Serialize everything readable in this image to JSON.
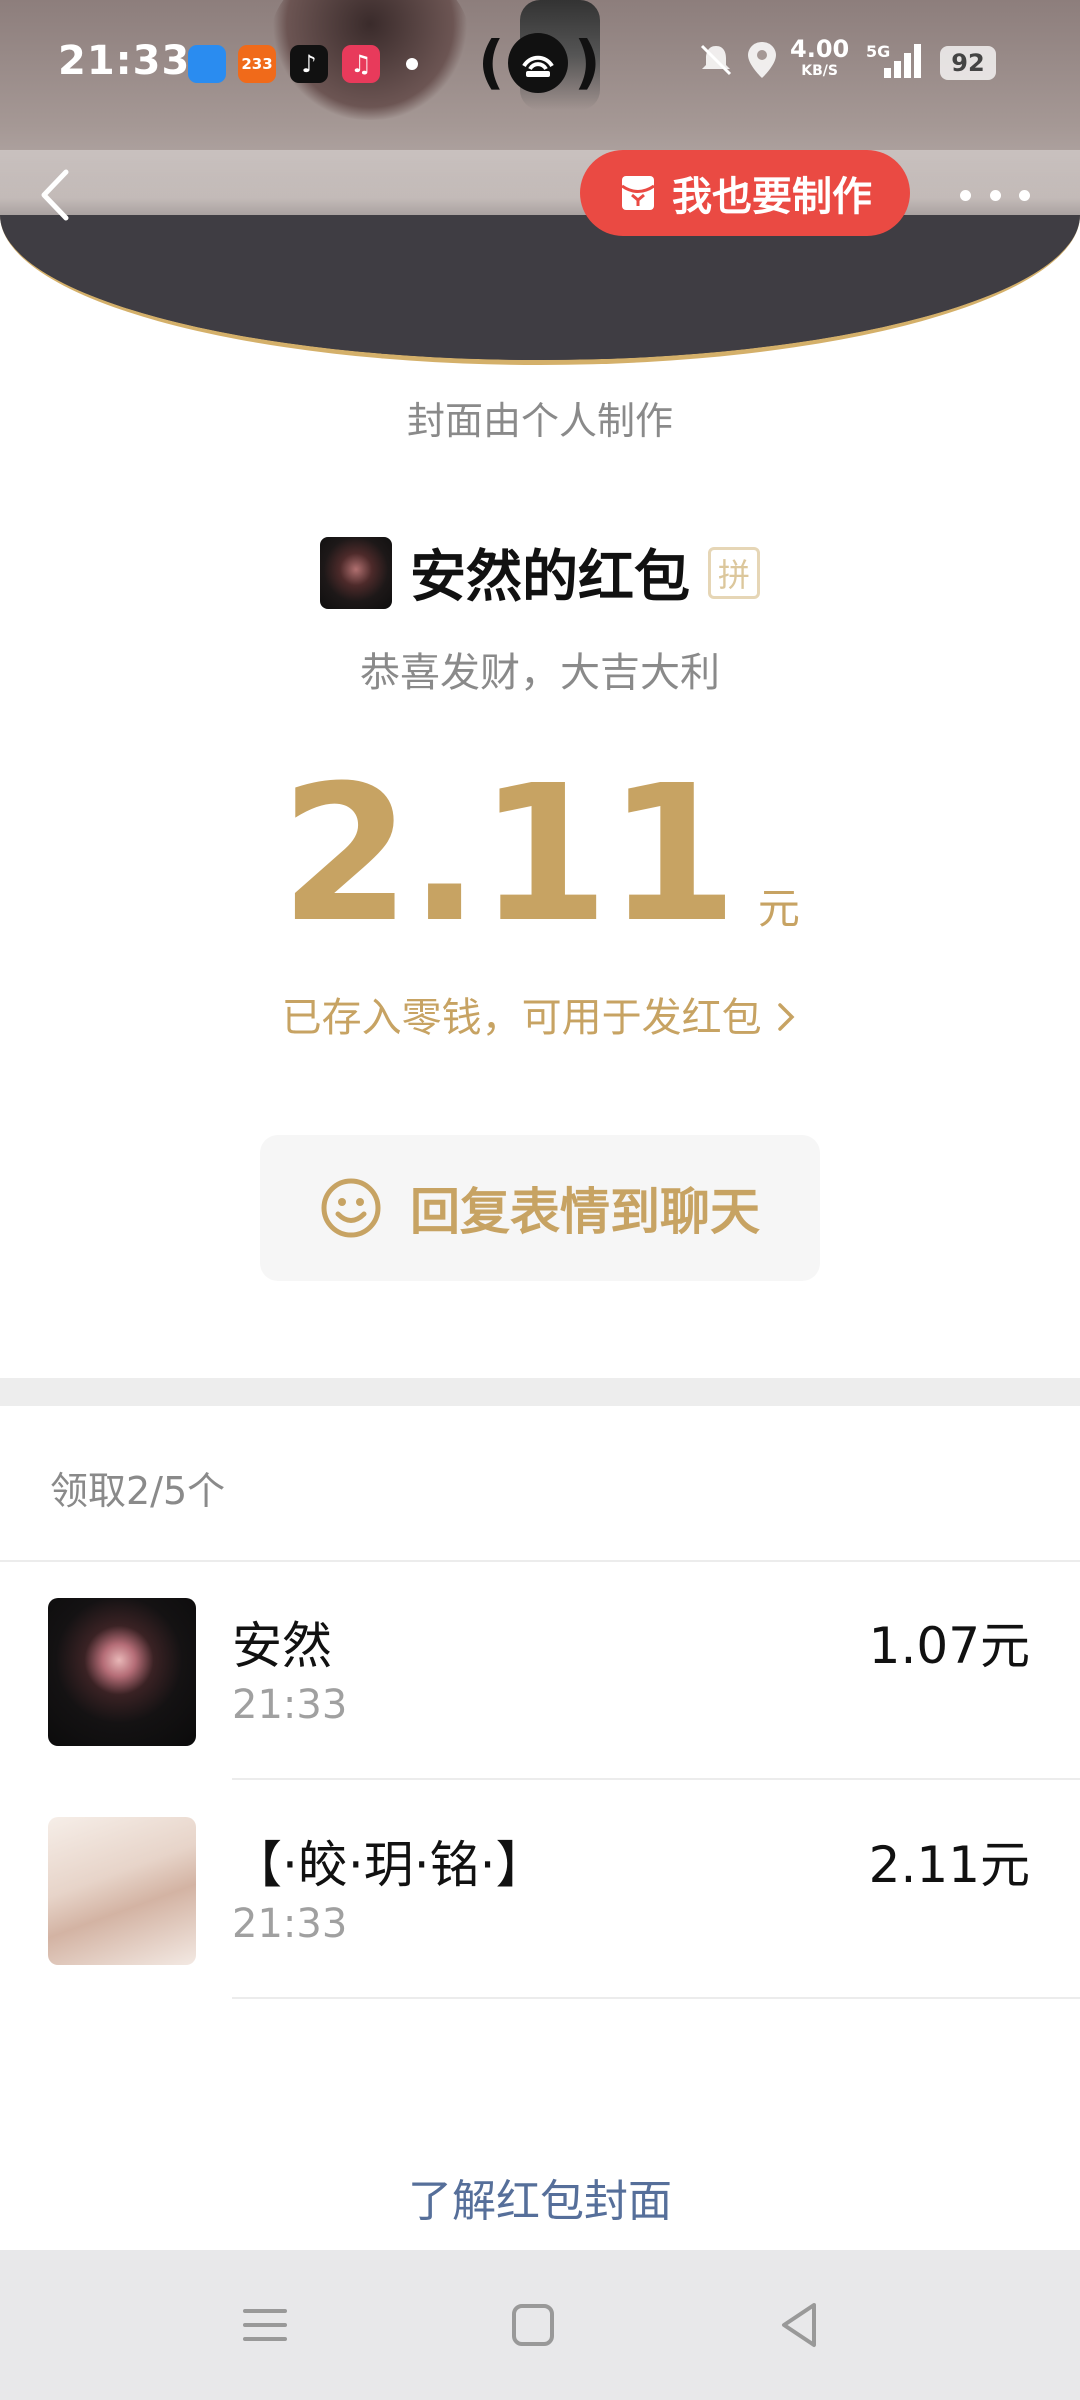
{
  "status_bar": {
    "time": "21:33",
    "net_speed": "4.00",
    "net_unit": "KB/S",
    "network": "5G",
    "battery": "92"
  },
  "header": {
    "make_button_label": "我也要制作"
  },
  "cover_note": "封面由个人制作",
  "sender": {
    "name": "安然的红包",
    "badge": "拼",
    "wish": "恭喜发财，大吉大利"
  },
  "amount": {
    "value": "2.11",
    "unit": "元",
    "saved_text": "已存入零钱，可用于发红包"
  },
  "reply_button_label": "回复表情到聊天",
  "received_summary": "领取2/5个",
  "receivers": [
    {
      "name": "安然",
      "time": "21:33",
      "amount": "1.07元"
    },
    {
      "name": "【·皎·玥·铭·】",
      "time": "21:33",
      "amount": "2.11元"
    }
  ],
  "learn_link": "了解红包封面",
  "colors": {
    "gold": "#c7a363",
    "red_button": "#ea4a43",
    "link_blue": "#566f9a"
  }
}
